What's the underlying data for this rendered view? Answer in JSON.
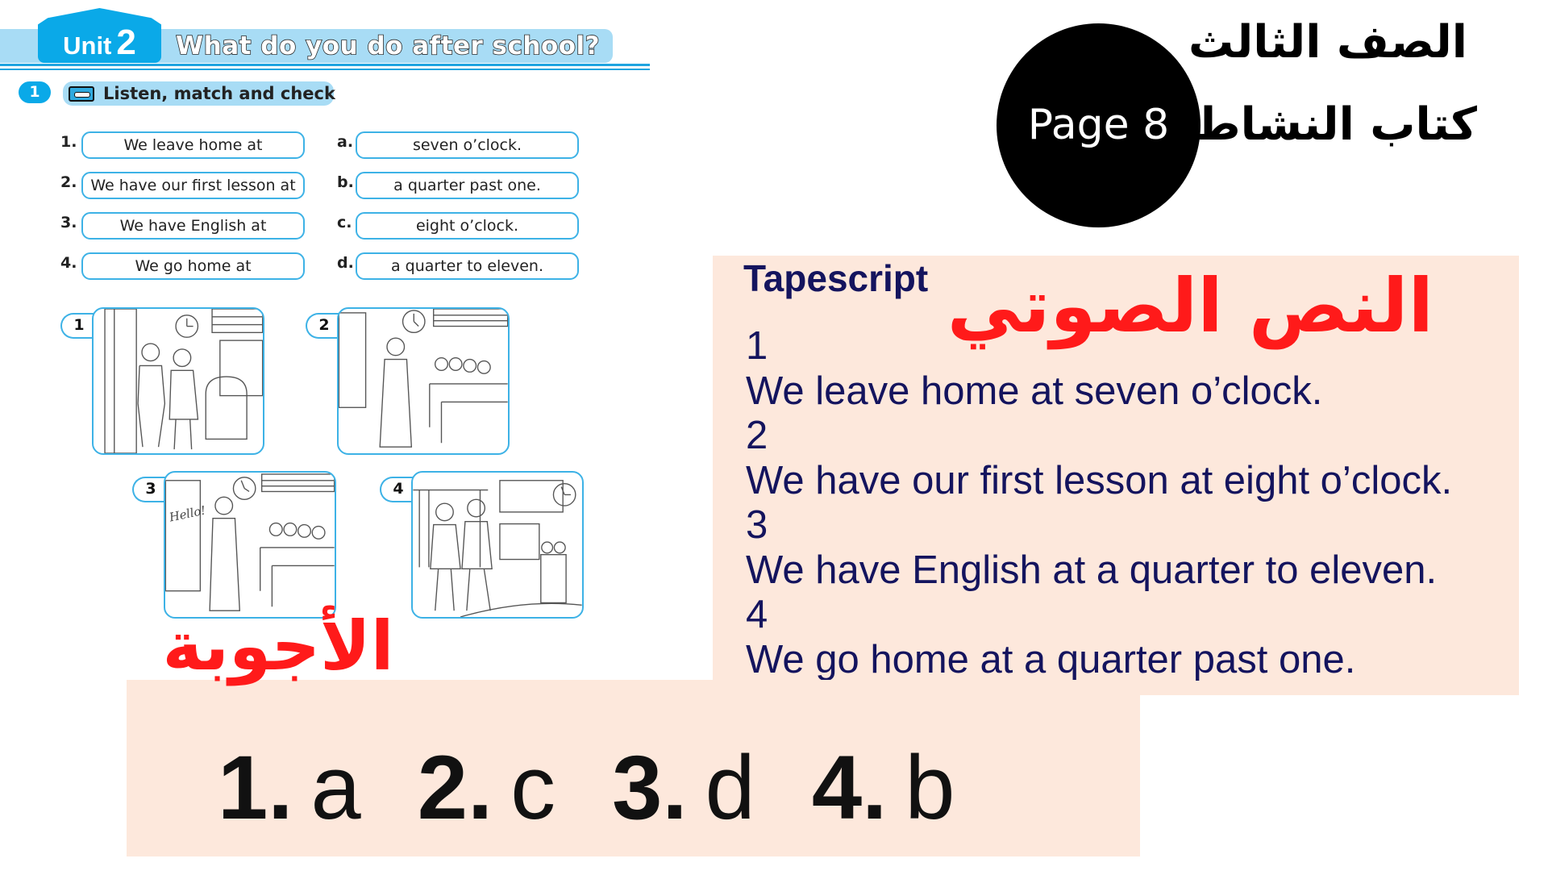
{
  "worksheet": {
    "unit_word": "Unit",
    "unit_number": "2",
    "unit_title": "What do you do after school?",
    "exercise": {
      "number": "1",
      "icon": "cassette-icon",
      "title": "Listen, match and check"
    },
    "left_items": [
      {
        "label": "1.",
        "text": "We leave home at"
      },
      {
        "label": "2.",
        "text": "We have our first lesson at"
      },
      {
        "label": "3.",
        "text": "We have English at"
      },
      {
        "label": "4.",
        "text": "We go home at"
      }
    ],
    "right_items": [
      {
        "label": "a.",
        "text": "seven o’clock."
      },
      {
        "label": "b.",
        "text": "a quarter past one."
      },
      {
        "label": "c.",
        "text": "eight o’clock."
      },
      {
        "label": "d.",
        "text": "a quarter to eleven."
      }
    ],
    "pictures": [
      {
        "number": "1",
        "scene": "boy and girl leaving home, clock at seven"
      },
      {
        "number": "2",
        "scene": "teacher in classroom, clock at eight"
      },
      {
        "number": "3",
        "scene": "teacher saying Hello in classroom, clock at quarter to eleven",
        "board_text": "Hello!"
      },
      {
        "number": "4",
        "scene": "students walking home outside school, clock at quarter past one"
      }
    ]
  },
  "page_badge": "Page 8",
  "grade_title": "الصف الثالث",
  "book_title": "كتاب النشاط",
  "tapescript": {
    "heading": "Tapescript",
    "arabic_heading": "النص الصوتي",
    "entries": [
      {
        "number": "1",
        "text": "We leave home at seven o’clock."
      },
      {
        "number": "2",
        "text": "We have our first lesson at eight o’clock."
      },
      {
        "number": "3",
        "text": "We have English at a quarter to eleven."
      },
      {
        "number": "4",
        "text": "We go home at a quarter past one."
      }
    ]
  },
  "answers": {
    "arabic_heading": "الأجوبة",
    "items": [
      {
        "number": "1.",
        "letter": "a"
      },
      {
        "number": "2.",
        "letter": "c"
      },
      {
        "number": "3.",
        "letter": "d"
      },
      {
        "number": "4.",
        "letter": "b"
      }
    ]
  },
  "colors": {
    "accent_blue": "#0aa9e8",
    "light_blue": "#a8dcf5",
    "peach": "#fde8dc",
    "navy_text": "#14145e",
    "red_heading": "#ff1a1a"
  }
}
